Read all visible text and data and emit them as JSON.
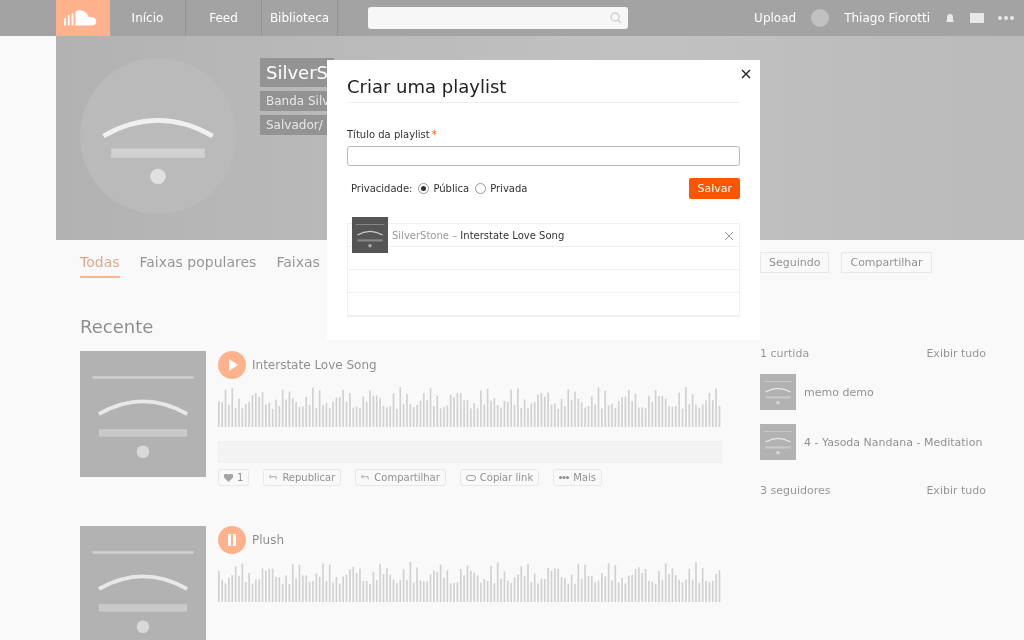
{
  "header": {
    "nav": [
      "Início",
      "Feed",
      "Biblioteca"
    ],
    "upload": "Upload",
    "user": "Thiago Fiorotti"
  },
  "profile": {
    "name": "SilverS",
    "lines": [
      "Banda Silv",
      "Salvador/"
    ]
  },
  "tabs": [
    {
      "label": "Todas",
      "selected": true
    },
    {
      "label": "Faixas populares",
      "selected": false
    },
    {
      "label": "Faixas",
      "selected": false
    }
  ],
  "section_title": "Recente",
  "tracks": [
    {
      "title": "Interstate Love Song",
      "playing": false,
      "actions": [
        {
          "kind": "like",
          "label": "1"
        },
        {
          "kind": "repost",
          "label": "Republicar"
        },
        {
          "kind": "share",
          "label": "Compartilhar"
        },
        {
          "kind": "link",
          "label": "Copiar link"
        },
        {
          "kind": "more",
          "label": "Mais"
        }
      ]
    },
    {
      "title": "Plush",
      "playing": true
    }
  ],
  "sidebar": {
    "follow": "Seguindo",
    "share": "Compartilhar",
    "likes_title": "1 curtida",
    "likes_link": "Exibir tudo",
    "liked": [
      {
        "title": "memo demo"
      },
      {
        "title": "4 - Yasoda Nandana - Meditation"
      }
    ],
    "followers_title": "3 seguidores",
    "followers_link": "Exibir tudo"
  },
  "dialog": {
    "title": "Criar uma playlist",
    "field_label": "Título da playlist",
    "required_mark": "*",
    "privacy_label": "Privacidade:",
    "privacy_options": [
      {
        "label": "Pública",
        "selected": true
      },
      {
        "label": "Privada",
        "selected": false
      }
    ],
    "save": "Salvar",
    "tracks": [
      {
        "artist": "SilverStone",
        "separator": "–",
        "title": "Interstate Love Song"
      }
    ]
  }
}
